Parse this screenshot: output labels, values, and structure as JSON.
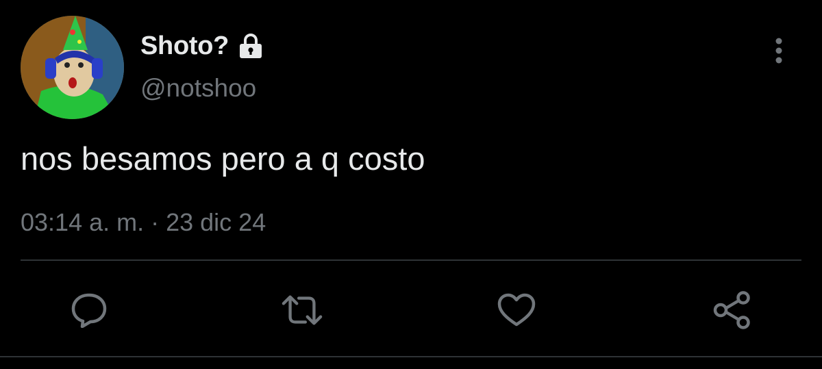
{
  "user": {
    "display_name": "Shoto?",
    "handle": "@notshoo",
    "avatar_icon": "avatar-icon",
    "protected_icon": "lock-icon"
  },
  "tweet": {
    "text": "nos besamos pero a q costo",
    "time": "03:14 a. m.",
    "separator": "·",
    "date": "23 dic 24"
  },
  "actions": {
    "reply_icon": "reply-icon",
    "retweet_icon": "retweet-icon",
    "like_icon": "heart-icon",
    "share_icon": "share-icon",
    "more_icon": "more-vertical-icon"
  },
  "colors": {
    "background": "#000000",
    "primary_text": "#e7e9ea",
    "secondary_text": "#71767b",
    "divider": "#2f3336"
  }
}
